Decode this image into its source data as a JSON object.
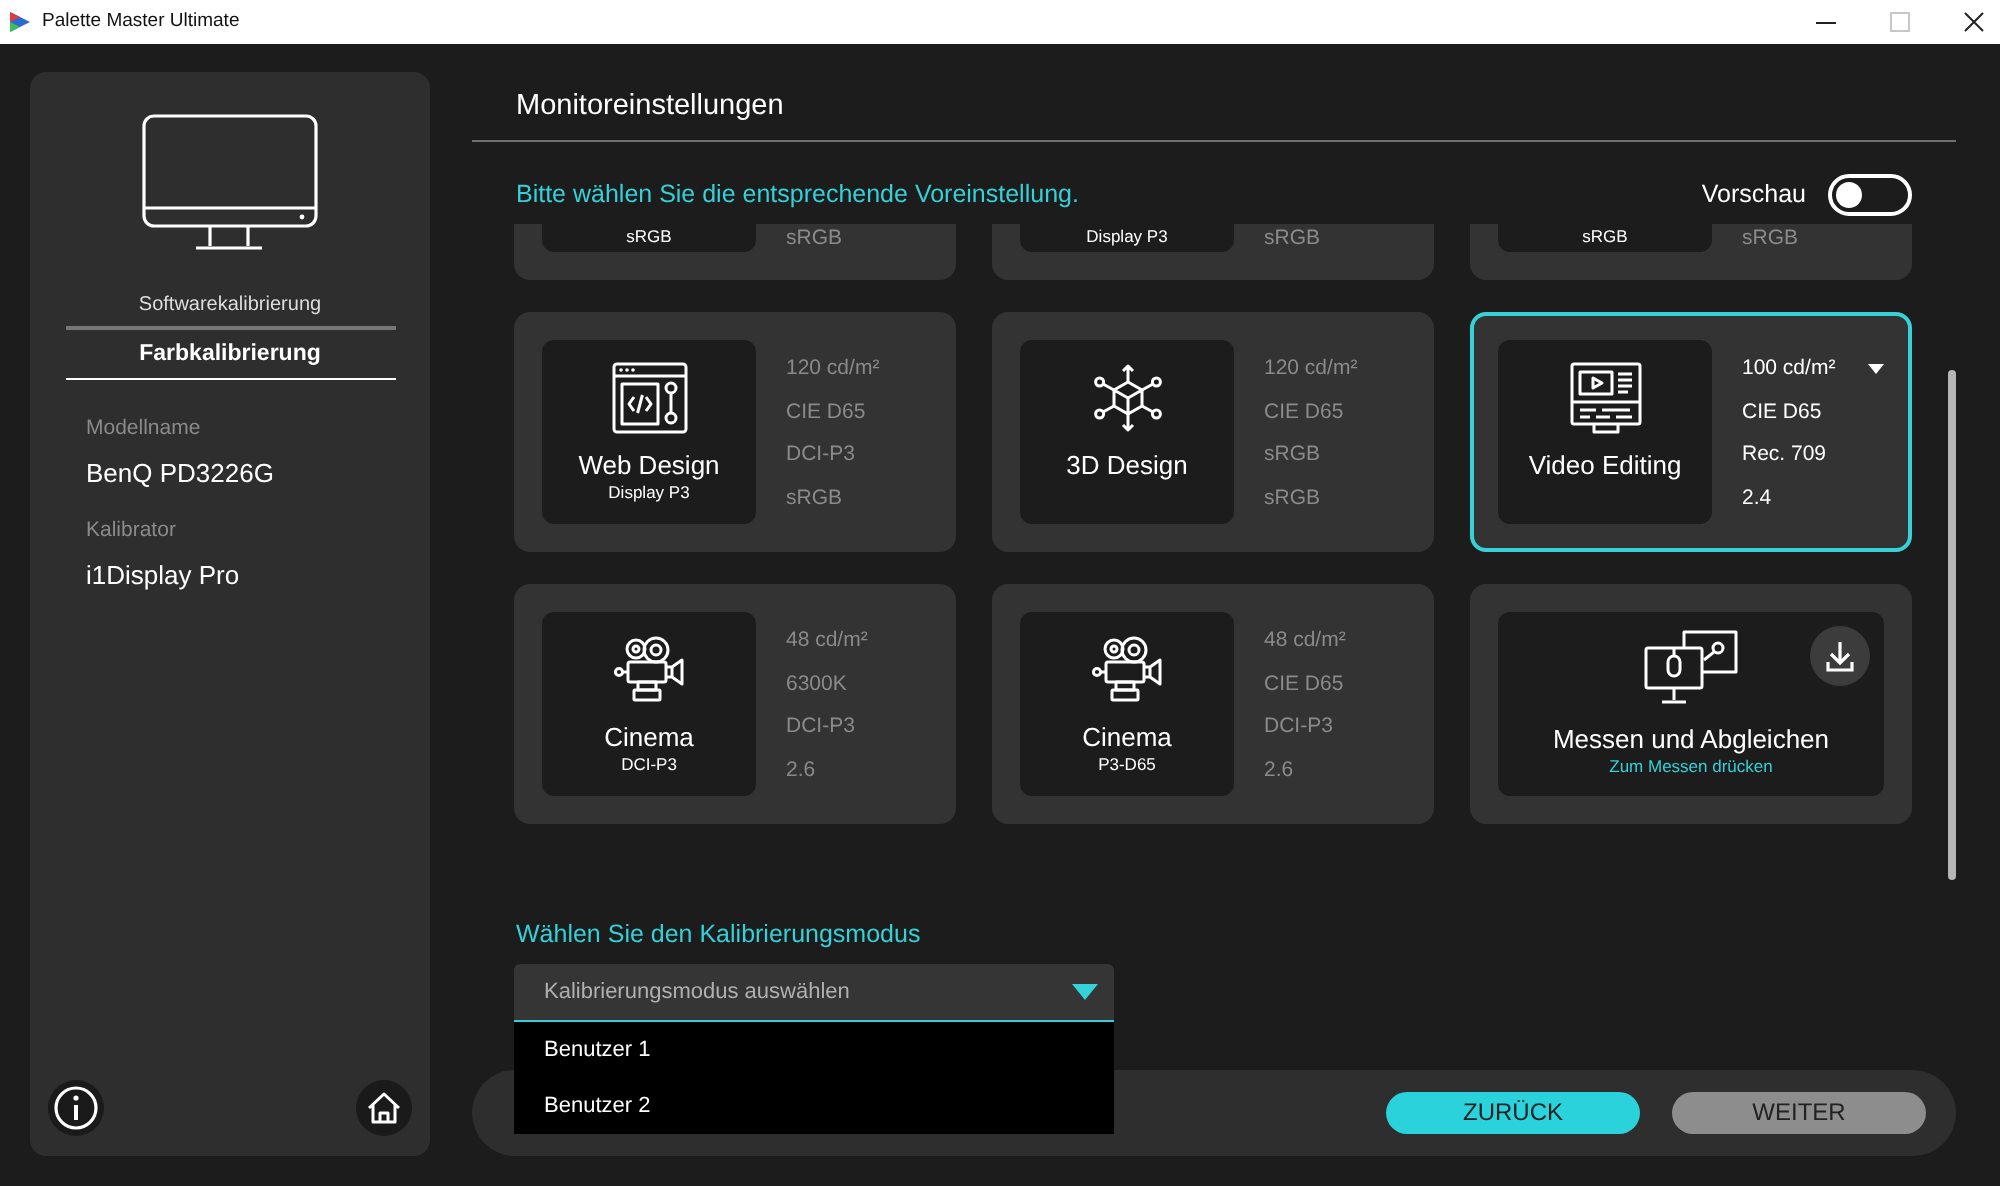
{
  "window": {
    "title": "Palette Master Ultimate",
    "controls": [
      {
        "kind": "minimize",
        "disabled": false
      },
      {
        "kind": "maximize",
        "disabled": true
      },
      {
        "kind": "close",
        "disabled": false
      }
    ]
  },
  "sidebar": {
    "tabs": [
      {
        "label": "Softwarekalibrierung",
        "selected": false
      },
      {
        "label": "Farbkalibrierung",
        "selected": true
      }
    ],
    "fields": [
      {
        "label": "Modellname",
        "value": "BenQ PD3226G"
      },
      {
        "label": "Kalibrator",
        "value": "i1Display Pro"
      }
    ]
  },
  "page": {
    "title": "Monitoreinstellungen",
    "prompt": "Bitte wählen Sie die entsprechende Voreinstellung.",
    "preview": {
      "label": "Vorschau",
      "on": false
    }
  },
  "presets": [
    {
      "kind": "partial",
      "subtitle": "sRGB",
      "specs": [
        "sRGB"
      ],
      "selected": false
    },
    {
      "kind": "partial",
      "subtitle": "Display P3",
      "specs": [
        "sRGB"
      ],
      "selected": false
    },
    {
      "kind": "partial",
      "subtitle": "sRGB",
      "specs": [
        "sRGB"
      ],
      "selected": false
    },
    {
      "kind": "web",
      "name": "Web Design",
      "subtitle": "Display P3",
      "specs": [
        "120 cd/m²",
        "CIE D65",
        "DCI-P3",
        "sRGB"
      ],
      "selected": false
    },
    {
      "kind": "modeling",
      "name": "3D Design",
      "specs": [
        "120 cd/m²",
        "CIE D65",
        "sRGB",
        "sRGB"
      ],
      "selected": false
    },
    {
      "kind": "video",
      "name": "Video Editing",
      "specs": [
        "100 cd/m²",
        "CIE D65",
        "Rec. 709",
        "2.4"
      ],
      "selected": true
    },
    {
      "kind": "cinema",
      "name": "Cinema",
      "subtitle": "DCI-P3",
      "specs": [
        "48 cd/m²",
        "6300K",
        "DCI-P3",
        "2.6"
      ],
      "selected": false
    },
    {
      "kind": "cinema",
      "name": "Cinema",
      "subtitle": "P3-D65",
      "specs": [
        "48 cd/m²",
        "CIE D65",
        "DCI-P3",
        "2.6"
      ],
      "selected": false
    },
    {
      "kind": "measure",
      "name": "Messen und Abgleichen",
      "hint": "Zum Messen drücken",
      "selected": false
    }
  ],
  "mode": {
    "label": "Wählen Sie den Kalibrierungsmodus",
    "placeholder": "Kalibrierungsmodus auswählen",
    "expanded": true,
    "options": [
      {
        "label": "Benutzer 1",
        "selected": false
      },
      {
        "label": "Benutzer 2",
        "selected": false
      }
    ]
  },
  "buttons": [
    {
      "label": "ZURÜCK",
      "kind": "primary"
    },
    {
      "label": "WEITER",
      "kind": "secondary"
    }
  ]
}
